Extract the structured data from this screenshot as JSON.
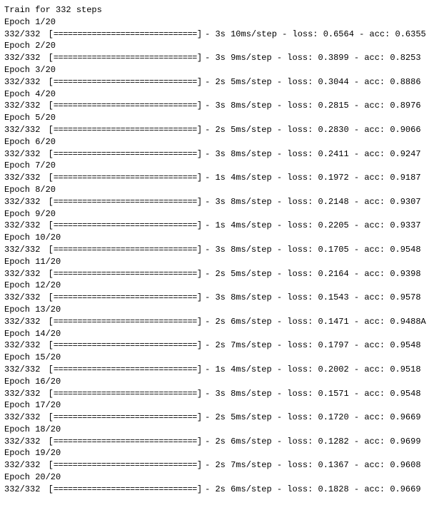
{
  "header": "Train for 332 steps",
  "steps_total": "332",
  "steps_current": "332",
  "progress_fill": "==============================",
  "epochs": [
    {
      "label": "Epoch 1/20",
      "time": "3s",
      "rate": "10ms/step",
      "loss": "0.6564",
      "acc": "0.6355"
    },
    {
      "label": "Epoch 2/20",
      "time": "3s",
      "rate": "9ms/step",
      "loss": "0.3899",
      "acc": "0.8253"
    },
    {
      "label": "Epoch 3/20",
      "time": "2s",
      "rate": "5ms/step",
      "loss": "0.3044",
      "acc": "0.8886"
    },
    {
      "label": "Epoch 4/20",
      "time": "3s",
      "rate": "8ms/step",
      "loss": "0.2815",
      "acc": "0.8976"
    },
    {
      "label": "Epoch 5/20",
      "time": "2s",
      "rate": "5ms/step",
      "loss": "0.2830",
      "acc": "0.9066"
    },
    {
      "label": "Epoch 6/20",
      "time": "3s",
      "rate": "8ms/step",
      "loss": "0.2411",
      "acc": "0.9247"
    },
    {
      "label": "Epoch 7/20",
      "time": "1s",
      "rate": "4ms/step",
      "loss": "0.1972",
      "acc": "0.9187"
    },
    {
      "label": "Epoch 8/20",
      "time": "3s",
      "rate": "8ms/step",
      "loss": "0.2148",
      "acc": "0.9307"
    },
    {
      "label": "Epoch 9/20",
      "time": "1s",
      "rate": "4ms/step",
      "loss": "0.2205",
      "acc": "0.9337"
    },
    {
      "label": "Epoch 10/20",
      "time": "3s",
      "rate": "8ms/step",
      "loss": "0.1705",
      "acc": "0.9548"
    },
    {
      "label": "Epoch 11/20",
      "time": "2s",
      "rate": "5ms/step",
      "loss": "0.2164",
      "acc": "0.9398"
    },
    {
      "label": "Epoch 12/20",
      "time": "3s",
      "rate": "8ms/step",
      "loss": "0.1543",
      "acc": "0.9578"
    },
    {
      "label": "Epoch 13/20",
      "time": "2s",
      "rate": "6ms/step",
      "loss": "0.1471",
      "acc": "0.9488A"
    },
    {
      "label": "Epoch 14/20",
      "time": "2s",
      "rate": "7ms/step",
      "loss": "0.1797",
      "acc": "0.9548"
    },
    {
      "label": "Epoch 15/20",
      "time": "1s",
      "rate": "4ms/step",
      "loss": "0.2002",
      "acc": "0.9518"
    },
    {
      "label": "Epoch 16/20",
      "time": "3s",
      "rate": "8ms/step",
      "loss": "0.1571",
      "acc": "0.9548"
    },
    {
      "label": "Epoch 17/20",
      "time": "2s",
      "rate": "5ms/step",
      "loss": "0.1720",
      "acc": "0.9669"
    },
    {
      "label": "Epoch 18/20",
      "time": "2s",
      "rate": "6ms/step",
      "loss": "0.1282",
      "acc": "0.9699"
    },
    {
      "label": "Epoch 19/20",
      "time": "2s",
      "rate": "7ms/step",
      "loss": "0.1367",
      "acc": "0.9608"
    },
    {
      "label": "Epoch 20/20",
      "time": "2s",
      "rate": "6ms/step",
      "loss": "0.1828",
      "acc": "0.9669"
    }
  ]
}
